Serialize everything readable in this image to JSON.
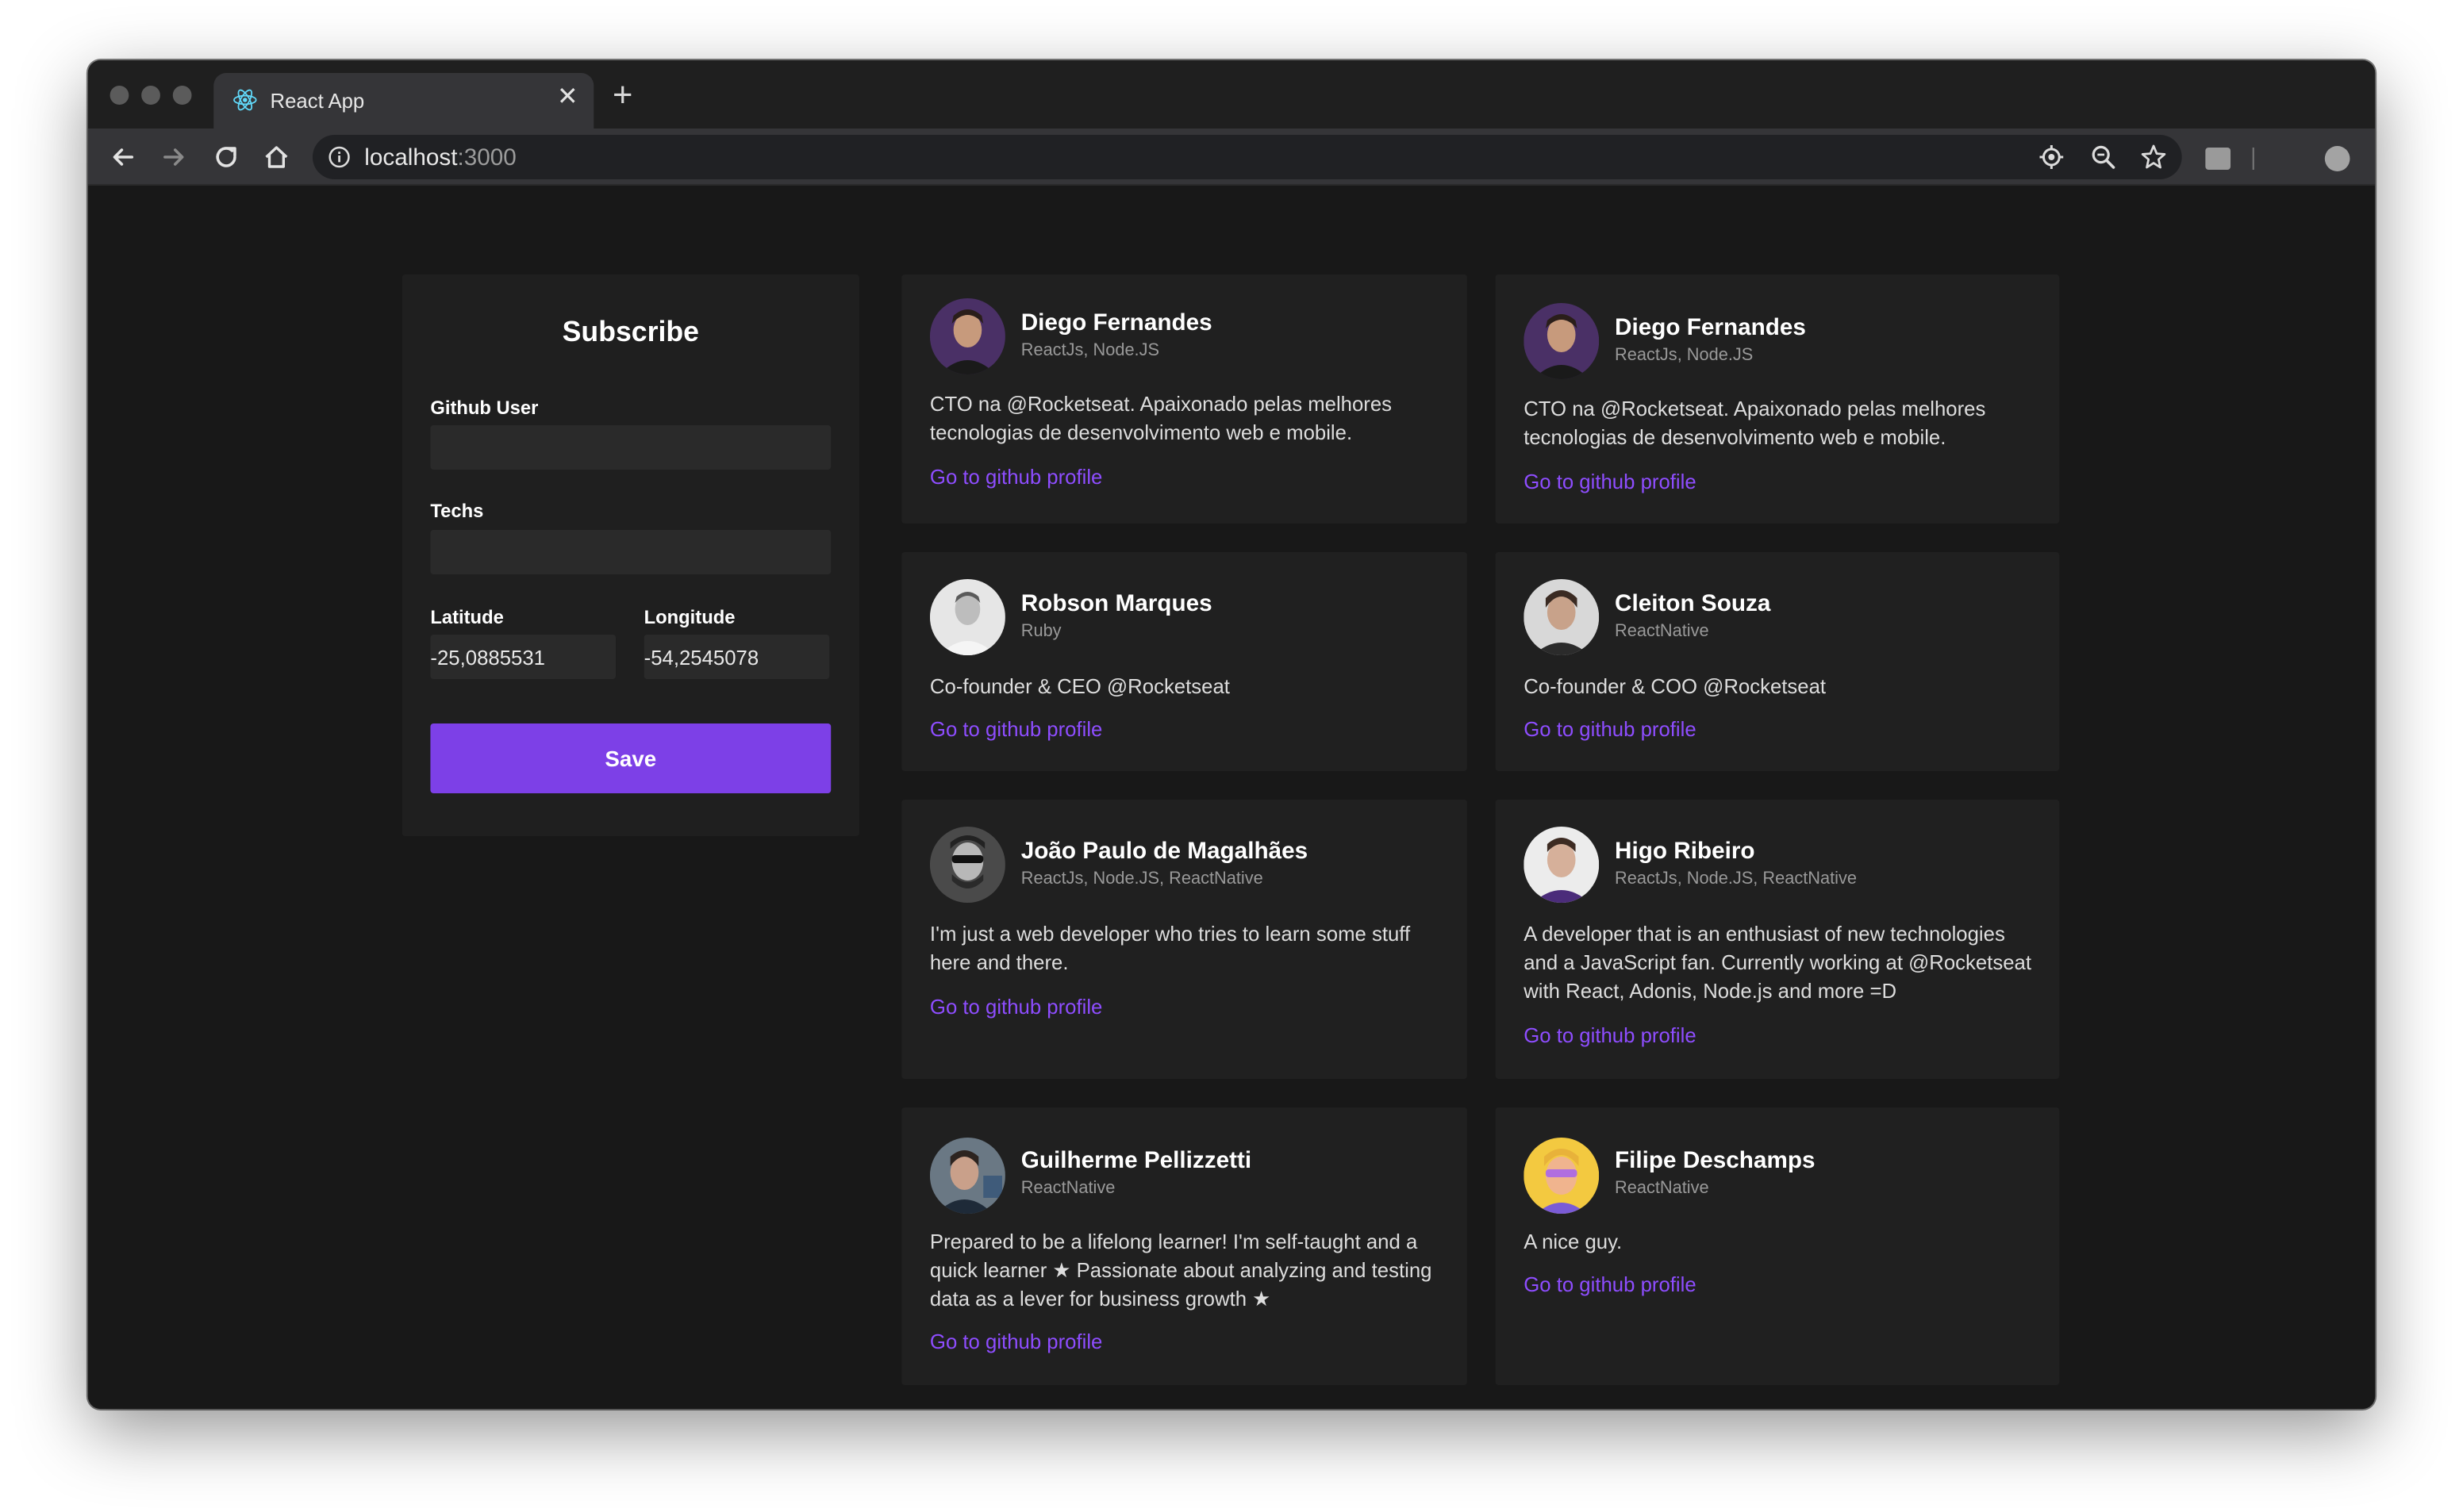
{
  "browser": {
    "tab_title": "React App",
    "close_label": "✕",
    "new_tab_label": "+",
    "url_host": "localhost",
    "url_port": ":3000"
  },
  "form": {
    "title": "Subscribe",
    "github_label": "Github User",
    "github_value": "",
    "techs_label": "Techs",
    "techs_value": "",
    "lat_label": "Latitude",
    "lat_value": "-25,0885531",
    "lng_label": "Longitude",
    "lng_value": "-54,2545078",
    "save_label": "Save"
  },
  "colors": {
    "accent": "#7d40e7",
    "link": "#8e4dff",
    "background": "#181818",
    "panel": "#1f1f1f"
  },
  "devs": [
    {
      "name": "Diego Fernandes",
      "techs": "ReactJs, Node.JS",
      "bio": "CTO na @Rocketseat. Apaixonado pelas melhores tecnologias de desenvolvimento web e mobile.",
      "link": "Go to github profile"
    },
    {
      "name": "Diego Fernandes",
      "techs": "ReactJs, Node.JS",
      "bio": "CTO na @Rocketseat. Apaixonado pelas melhores tecnologias de desenvolvimento web e mobile.",
      "link": "Go to github profile"
    },
    {
      "name": "Robson Marques",
      "techs": "Ruby",
      "bio": "Co-founder & CEO @Rocketseat",
      "link": "Go to github profile"
    },
    {
      "name": "Cleiton Souza",
      "techs": "ReactNative",
      "bio": "Co-founder & COO @Rocketseat",
      "link": "Go to github profile"
    },
    {
      "name": "João Paulo de Magalhães",
      "techs": "ReactJs, Node.JS, ReactNative",
      "bio": "I'm just a web developer who tries to learn some stuff here and there.",
      "link": "Go to github profile"
    },
    {
      "name": "Higo Ribeiro",
      "techs": "ReactJs, Node.JS, ReactNative",
      "bio": "A developer that is an enthusiast of new technologies and a JavaScript fan. Currently working at @Rocketseat with React, Adonis, Node.js and more =D",
      "link": "Go to github profile"
    },
    {
      "name": "Guilherme Pellizzetti",
      "techs": "ReactNative",
      "bio": "Prepared to be a lifelong learner! I'm self-taught and a quick learner ★ Passionate about analyzing and testing data as a lever for business growth ★",
      "link": "Go to github profile"
    },
    {
      "name": "Filipe Deschamps",
      "techs": "ReactNative",
      "bio": "A nice guy.",
      "link": "Go to github profile"
    }
  ]
}
